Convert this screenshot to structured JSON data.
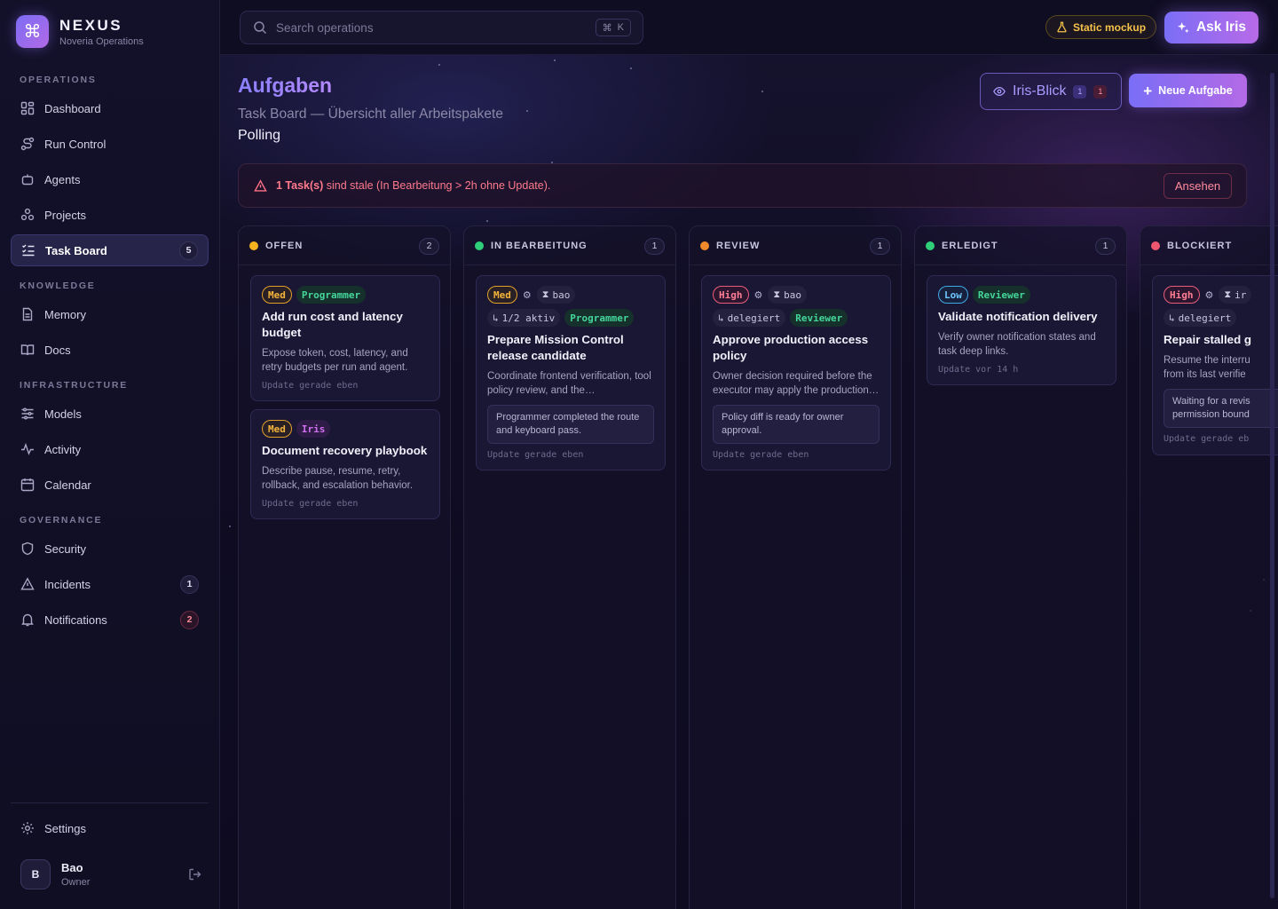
{
  "brand": {
    "name": "NEXUS",
    "subtitle": "Noveria Operations"
  },
  "sidebar": {
    "sections": [
      "OPERATIONS",
      "KNOWLEDGE",
      "INFRASTRUCTURE",
      "GOVERNANCE"
    ],
    "items": [
      {
        "label": "Dashboard",
        "icon": "dashboard-icon"
      },
      {
        "label": "Run Control",
        "icon": "route-icon"
      },
      {
        "label": "Agents",
        "icon": "bot-icon"
      },
      {
        "label": "Projects",
        "icon": "projects-icon"
      },
      {
        "label": "Task Board",
        "icon": "list-checks-icon",
        "badge": "5",
        "active": true
      },
      {
        "label": "Memory",
        "icon": "file-icon"
      },
      {
        "label": "Docs",
        "icon": "book-icon"
      },
      {
        "label": "Models",
        "icon": "sliders-icon"
      },
      {
        "label": "Activity",
        "icon": "activity-icon"
      },
      {
        "label": "Calendar",
        "icon": "calendar-icon"
      },
      {
        "label": "Security",
        "icon": "shield-icon"
      },
      {
        "label": "Incidents",
        "icon": "alert-triangle-icon",
        "badge": "1"
      },
      {
        "label": "Notifications",
        "icon": "bell-icon",
        "badge": "2"
      }
    ],
    "settings": "Settings",
    "user": {
      "initial": "B",
      "name": "Bao",
      "role": "Owner"
    }
  },
  "topbar": {
    "search_placeholder": "Search operations",
    "shortcut_cmd": "⌘",
    "shortcut_key": "K",
    "mock_badge": "Static mockup",
    "ask_iris": "Ask Iris"
  },
  "page": {
    "title": "Aufgaben",
    "subtitle": "Task Board — Übersicht aller Arbeitspakete",
    "status": "Polling",
    "iris_blick": {
      "label": "Iris-Blick",
      "count_a": "1",
      "count_b": "1"
    },
    "new_task": "Neue Aufgabe"
  },
  "alert": {
    "bold": "1 Task(s)",
    "text": " sind stale (In Bearbeitung > 2h ohne Update).",
    "action": "Ansehen"
  },
  "colors": {
    "accent": "#7a6ef6",
    "offen": "#f5b11e",
    "in_bearbeitung": "#2fcf7a",
    "review": "#f08a2a",
    "erledigt": "#2fcf7a",
    "blockiert": "#f0566e"
  },
  "columns": [
    {
      "title": "OFFEN",
      "count": "2",
      "cards": [
        {
          "priority": "Med",
          "role": "Programmer",
          "title": "Add run cost and latency budget",
          "desc": "Expose token, cost, latency, and retry budgets per run and agent.",
          "update": "Update gerade eben"
        },
        {
          "priority": "Med",
          "role": "Iris",
          "title": "Document recovery playbook",
          "desc": "Describe pause, resume, retry, rollback, and escalation behavior.",
          "update": "Update gerade eben"
        }
      ]
    },
    {
      "title": "IN BEARBEITUNG",
      "count": "1",
      "cards": [
        {
          "priority": "Med",
          "assignee": "bao",
          "sub": "1/2 aktiv",
          "role": "Programmer",
          "title": "Prepare Mission Control release candidate",
          "desc": "Coordinate frontend verification, tool policy review, and the…",
          "note": "Programmer completed the route and keyboard pass.",
          "update": "Update gerade eben"
        }
      ]
    },
    {
      "title": "REVIEW",
      "count": "1",
      "cards": [
        {
          "priority": "High",
          "assignee": "bao",
          "sub": "delegiert",
          "role": "Reviewer",
          "title": "Approve production access policy",
          "desc": "Owner decision required before the executor may apply the production…",
          "note": "Policy diff is ready for owner approval.",
          "update": "Update gerade eben"
        }
      ]
    },
    {
      "title": "ERLEDIGT",
      "count": "1",
      "cards": [
        {
          "priority": "Low",
          "role": "Reviewer",
          "title": "Validate notification delivery",
          "desc": "Verify owner notification states and task deep links.",
          "update": "Update vor 14 h"
        }
      ]
    },
    {
      "title": "BLOCKIERT",
      "count": "",
      "cards": [
        {
          "priority": "High",
          "assignee": "ir",
          "sub": "delegiert",
          "title": "Repair stalled g",
          "desc_l1": "Resume the interru",
          "desc_l2": "from its last verifie",
          "note_l1": "Waiting for a revis",
          "note_l2": "permission bound",
          "update": "Update gerade eb"
        }
      ]
    }
  ]
}
